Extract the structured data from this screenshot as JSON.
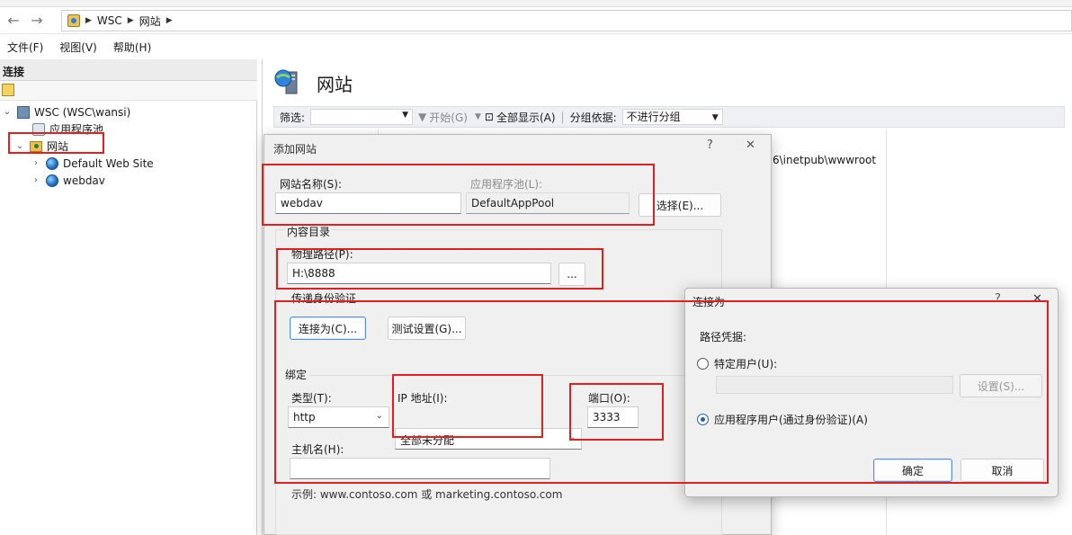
{
  "address_bar": {
    "back": "←",
    "forward": "→",
    "path": [
      "WSC",
      "网站"
    ]
  },
  "menu": [
    "文件(F)",
    "视图(V)",
    "帮助(H)"
  ],
  "connections": {
    "header": "连接",
    "tree": {
      "server": "WSC (WSC\\wansi)",
      "app_pools": "应用程序池",
      "sites": "网站",
      "site_items": [
        "Default Web Site",
        "webdav"
      ]
    }
  },
  "main": {
    "title": "网站",
    "filter_label": "筛选:",
    "start_label": "开始(G)",
    "show_all_label": "全部显示(A)",
    "group_by_label": "分组依据:",
    "group_by_value": "不进行分组",
    "path_fragment": "6\\inetpub\\wwwroot"
  },
  "add_site_dialog": {
    "title": "添加网站",
    "help": "?",
    "close": "✕",
    "site_name_label": "网站名称(S):",
    "site_name_value": "webdav",
    "app_pool_label": "应用程序池(L):",
    "app_pool_value": "DefaultAppPool",
    "select_button": "选择(E)...",
    "content_dir_label": "内容目录",
    "physical_path_label": "物理路径(P):",
    "physical_path_value": "H:\\8888",
    "browse_button": "...",
    "passthrough_label": "传递身份验证",
    "connect_as_button": "连接为(C)...",
    "test_settings_button": "测试设置(G)...",
    "binding_label": "绑定",
    "type_label": "类型(T):",
    "type_value": "http",
    "ip_label": "IP 地址(I):",
    "ip_value": "全部未分配",
    "port_label": "端口(O):",
    "port_value": "3333",
    "hostname_label": "主机名(H):",
    "hostname_value": "",
    "example_text": "示例: www.contoso.com 或 marketing.contoso.com"
  },
  "connect_as_dialog": {
    "title": "连接为",
    "help": "?",
    "close": "✕",
    "path_credentials_label": "路径凭据:",
    "specific_user_label": "特定用户(U):",
    "settings_button": "设置(S)...",
    "app_user_label": "应用程序用户(通过身份验证)(A)",
    "ok_button": "确定",
    "cancel_button": "取消",
    "selected": "应用程序用户(通过身份验证)(A)"
  },
  "colors": {
    "annotation_red": "#e02020",
    "accent_blue": "#1f5fbf"
  }
}
